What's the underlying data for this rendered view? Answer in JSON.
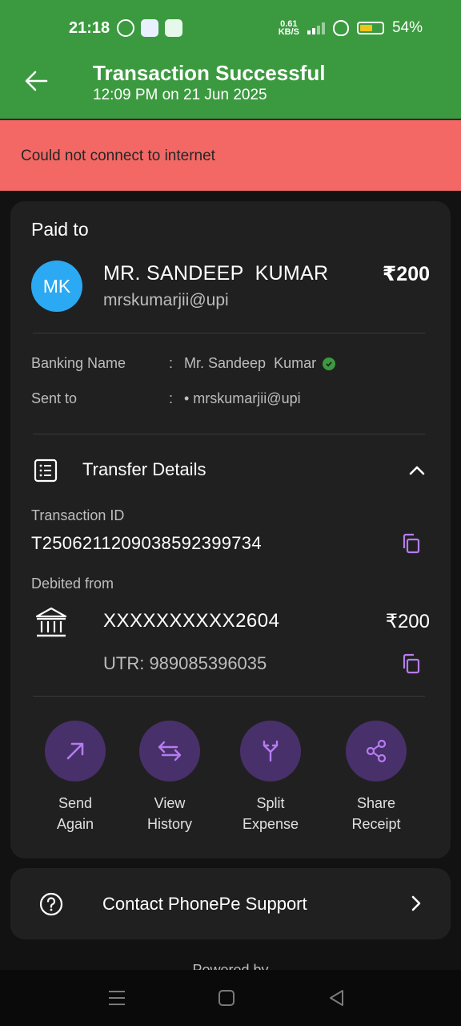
{
  "status_bar": {
    "time": "21:18",
    "speed_value": "0.61",
    "speed_unit": "KB/S",
    "battery": "54%"
  },
  "header": {
    "title": "Transaction Successful",
    "subtitle": "12:09 PM on 21 Jun 2025",
    "back_icon": "arrow-left-icon",
    "color": "#3b9a3f"
  },
  "banner": {
    "text": "Could not connect to internet",
    "color": "#f36865"
  },
  "payment": {
    "paid_to_label": "Paid to",
    "avatar_initials": "MK",
    "avatar_color": "#2ba9f3",
    "payee_name": "MR. SANDEEP  KUMAR",
    "payee_upi": "mrskumarjii@upi",
    "amount": "₹200",
    "banking_name_label": "Banking Name",
    "banking_name_value": "Mr. Sandeep  Kumar",
    "sent_to_label": "Sent to",
    "sent_to_value": "• mrskumarjii@upi",
    "colon": ":"
  },
  "transfer_details": {
    "title": "Transfer Details",
    "transaction_id_label": "Transaction ID",
    "transaction_id": "T2506211209038592399734",
    "debited_from_label": "Debited from",
    "account": "XXXXXXXXXX2604",
    "account_amount": "₹200",
    "utr": "UTR: 989085396035"
  },
  "actions": [
    {
      "label": "Send\nAgain",
      "icon": "arrow-up-right-icon"
    },
    {
      "label": "View\nHistory",
      "icon": "swap-arrows-icon"
    },
    {
      "label": "Split\nExpense",
      "icon": "split-icon"
    },
    {
      "label": "Share\nReceipt",
      "icon": "share-icon"
    }
  ],
  "support": {
    "label": "Contact PhonePe Support",
    "icon": "help-circle-icon"
  },
  "footer": {
    "powered_by": "Powered by"
  },
  "accent_color": "#b57cf0"
}
